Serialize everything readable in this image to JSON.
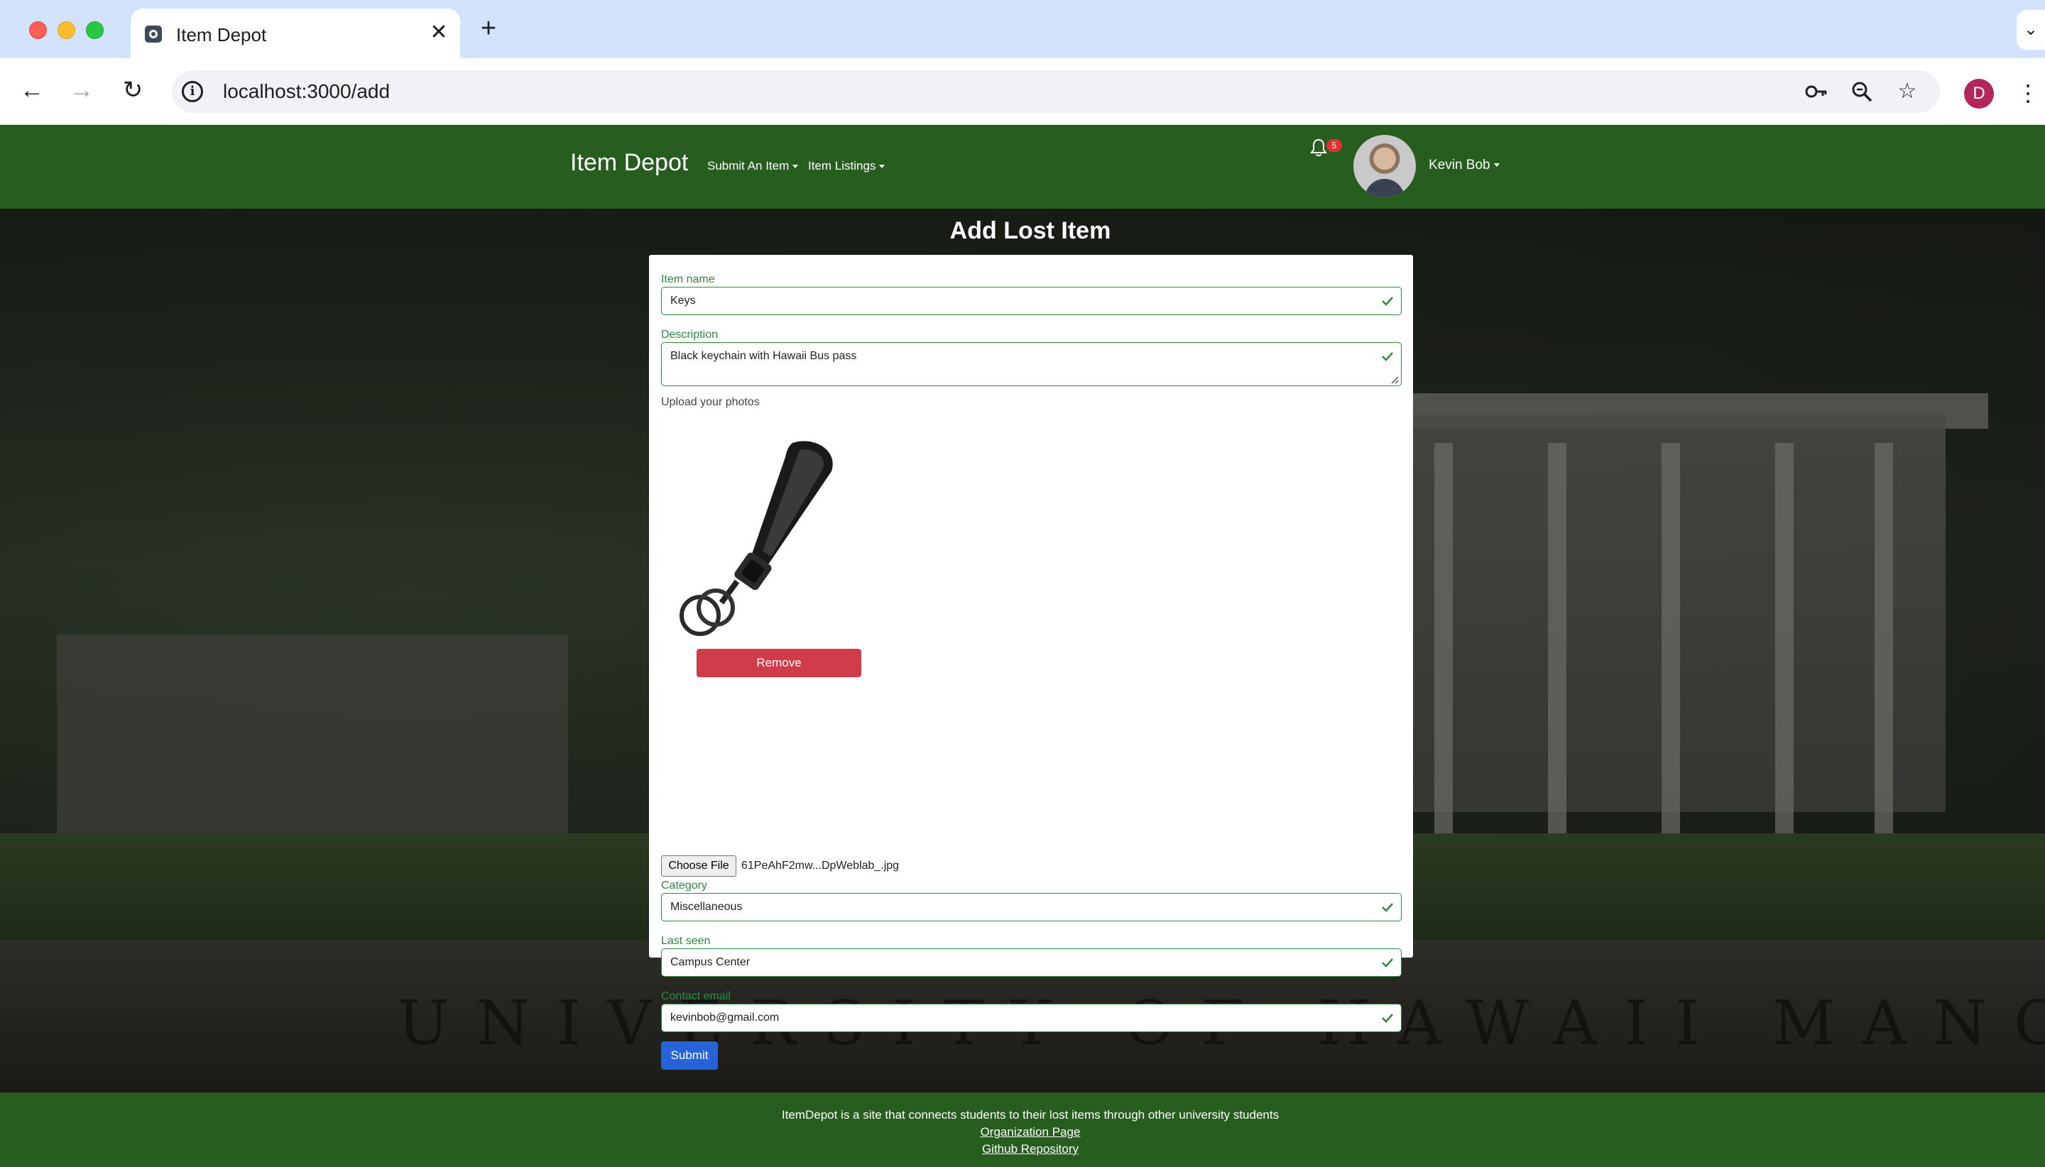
{
  "browser": {
    "tab_title": "Item Depot",
    "url": "localhost:3000/add",
    "profile_initial": "D",
    "tab_close": "✕",
    "new_tab": "+",
    "tab_menu": "⌄"
  },
  "navbar": {
    "brand": "Item Depot",
    "menu_submit": "Submit An Item",
    "menu_listings": "Item Listings",
    "notification_count": "5",
    "user_name": "Kevin Bob"
  },
  "form": {
    "title": "Add Lost Item",
    "item_name_label": "Item name",
    "item_name_value": "Keys",
    "description_label": "Description",
    "description_value": "Black keychain with Hawaii Bus pass",
    "upload_label": "Upload your photos",
    "remove_label": "Remove",
    "choose_file_label": "Choose File",
    "file_name": "61PeAhF2mw...DpWeblab_.jpg",
    "category_label": "Category",
    "category_value": "Miscellaneous",
    "last_seen_label": "Last seen",
    "last_seen_value": "Campus Center",
    "contact_label": "Contact email",
    "contact_value": "kevinbob@gmail.com",
    "submit_label": "Submit"
  },
  "footer": {
    "text": "ItemDepot is a site that connects students to their lost items through other university students",
    "org_link": "Organization Page",
    "github_link": "Github Repository"
  },
  "background": {
    "wall_text": "UNIVERSITY OF HAWAII MANOA"
  },
  "colors": {
    "navbar": "#275e1f",
    "field_border": "#2e8b3d",
    "remove": "#d03c4a",
    "submit": "#2763d6"
  }
}
